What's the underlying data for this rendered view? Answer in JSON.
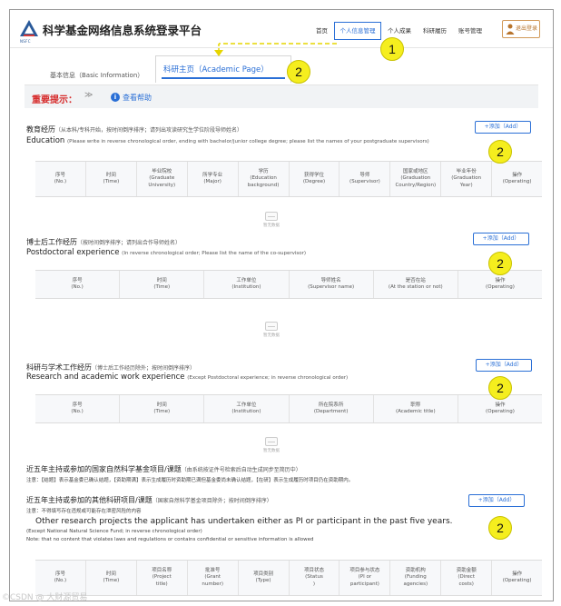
{
  "header": {
    "site_title": "科学基金网络信息系统登录平台",
    "logo_sub": "NSFC",
    "nav": [
      "首页",
      "个人信息管理",
      "个人成果",
      "科研履历",
      "账号管理"
    ],
    "logout_label": "退出登录"
  },
  "badges": [
    "1",
    "2",
    "2",
    "2",
    "2",
    "2"
  ],
  "tabs": {
    "basic": "基本信息（Basic Information）",
    "academic": "科研主页（Academic Page）"
  },
  "notice": {
    "title": "重要提示：",
    "chevron": "≫",
    "help": "查看帮助"
  },
  "add_label": "+添加（Add）",
  "empty_text": "暂无数据",
  "education": {
    "title_cn": "教育经历",
    "hint_cn": "（从本科/专科开始，按时间倒序排序；请列出攻读研究生学位阶段导师姓名）",
    "title_en": "Education",
    "hint_en": "(Please write in reverse chronological order, ending with bachelor/junior college degree; please list the names of your postgraduate supervisors)",
    "columns": [
      "序号\n(No.)",
      "时间\n(Time)",
      "毕业院校\n(Graduate\nUniversity)",
      "所学专业\n(Major)",
      "学历\n(Education\nbackground)",
      "获得学位\n(Degree)",
      "导师\n(Supervisor)",
      "国家或地区\n(Graduation\nCountry/Region)",
      "毕业年份\n(Graduation\nYear)",
      "操作\n(Operating)"
    ]
  },
  "postdoc": {
    "title_cn": "博士后工作经历",
    "hint_cn": "（按时间倒序排序；请列出合作导师姓名）",
    "title_en": "Postdoctoral experience",
    "hint_en": "(In reverse chronological order; Please list the name of the co-supervisor)",
    "columns": [
      "序号\n(No.)",
      "时间\n(Time)",
      "工作单位\n(Institution)",
      "导师姓名\n(Supervisor name)",
      "是否在站\n(At the station or not)",
      "操作\n(Operating)"
    ]
  },
  "work": {
    "title_cn": "科研与学术工作经历",
    "hint_cn": "（博士后工作经历除外；按时间倒序排序）",
    "title_en": "Research and academic work experience",
    "hint_en": "(Except Postdoctoral experience; in reverse chronological order)",
    "columns": [
      "序号\n(No.)",
      "时间\n(Time)",
      "工作单位\n(Institution)",
      "所在院系所\n(Department)",
      "职称\n(Academic title)",
      "操作\n(Operating)"
    ]
  },
  "nsfc_projects": {
    "title_cn": "近五年主持或参加的国家自然科学基金项目/课题",
    "hint_cn": "（由系统按证件号检索后自动生成同步至简历中）",
    "note": "注意：【结题】表示基金委已确认结题，【资助期满】表示生成履历时资助期已满但基金委尚未确认结题，【在研】表示生成履历时项目仍在资助期内。"
  },
  "other_projects": {
    "title_cn": "近五年主持或参加的其他科研项目/课题",
    "hint_cn": "（国家自然科学基金项目除外；按时间倒序排序）",
    "note_cn": "注意：不得填写存在违规或可能存在泄密风险的内容",
    "title_en": "Other research projects the applicant has undertaken either as PI or participant in the past five years.",
    "hint_en": "(Except National Natural Science Fund; in reverse chronological order)",
    "note_en": "Note: that no content that violates laws and regulations or contains confidential or sensitive information is allowed",
    "columns": [
      "序号\n(No.)",
      "时间\n(Time)",
      "项目名称\n(Project\ntitle)",
      "批准号\n(Grant\nnumber)",
      "项目类别\n(Type)",
      "项目状态\n(Status\n)",
      "项目参与状态\n(PI or\nparticipant)",
      "资助机构\n(Funding\nagencies)",
      "资助金额\n(Direct\ncosts)",
      "操作\n(Operating)"
    ]
  },
  "watermark": "©CSDN @ 大财源贸易",
  "colors": {
    "accent": "#2a6fd6",
    "notice_red": "#d62b2b",
    "badge": "#f5ee1e"
  }
}
